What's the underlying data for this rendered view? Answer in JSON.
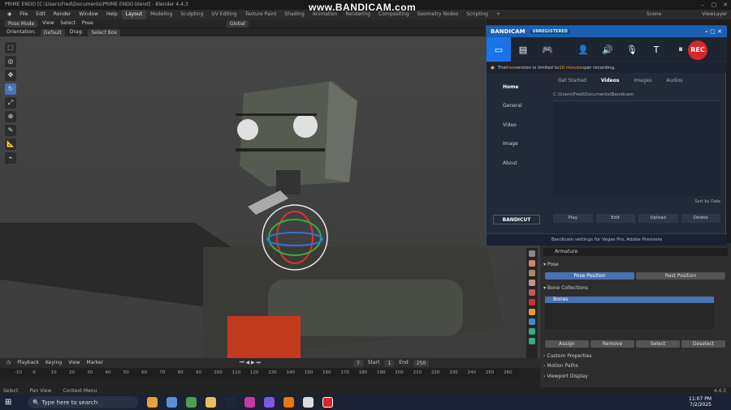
{
  "watermark": "www.BANDICAM.com",
  "blender": {
    "window_title": "PRIME ENDO [C:\\Users\\Fred\\Documents\\PRIME ENDO.blend] - Blender 4.4.3",
    "menu": [
      "File",
      "Edit",
      "Render",
      "Window",
      "Help"
    ],
    "workspaces": [
      "Layout",
      "Modeling",
      "Sculpting",
      "UV Editing",
      "Texture Paint",
      "Shading",
      "Animation",
      "Rendering",
      "Compositing",
      "Geometry Nodes",
      "Scripting"
    ],
    "scene": "Scene",
    "view_layer": "ViewLayer",
    "header": {
      "mode": "Pose Mode",
      "view": "View",
      "select": "Select",
      "pose": "Pose",
      "orientation_label": "Orientation:",
      "orientation": "Default",
      "drag_label": "Drag:",
      "drag": "Select Box",
      "transform": "Global"
    },
    "properties": {
      "object": "Armature",
      "pose_section": "Pose",
      "pose_position": "Pose Position",
      "rest_position": "Rest Position",
      "bone_collections": "Bone Collections",
      "bones": "Bones",
      "assign": "Assign",
      "remove": "Remove",
      "select": "Select",
      "deselect": "Deselect",
      "custom_properties": "Custom Properties",
      "motion_paths": "Motion Paths",
      "viewport_display": "Viewport Display"
    },
    "timeline": {
      "playback": "Playback",
      "keying": "Keying",
      "view": "View",
      "marker": "Marker",
      "current_frame": "7",
      "start_label": "Start",
      "start": "1",
      "end_label": "End",
      "end": "250",
      "ticks": [
        "-10",
        "0",
        "10",
        "20",
        "30",
        "40",
        "50",
        "60",
        "70",
        "80",
        "90",
        "100",
        "110",
        "120",
        "130",
        "140",
        "150",
        "160",
        "170",
        "180",
        "190",
        "200",
        "210",
        "220",
        "230",
        "240",
        "250",
        "260"
      ]
    },
    "status": {
      "select": "Select",
      "pan": "Pan View",
      "context": "Context Menu",
      "version": "4.4.3"
    }
  },
  "bandicam": {
    "brand": "BANDICAM",
    "badge": "UNREGISTERED",
    "rec": "REC",
    "notice_prefix": "The ",
    "notice_free": "free",
    "notice_mid": " version is limited to ",
    "notice_limit": "10 minutes",
    "notice_suffix": " per recording.",
    "nav": [
      "Home",
      "General",
      "Video",
      "Image",
      "About"
    ],
    "tabs": [
      "Get Started",
      "Videos",
      "Images",
      "Audios"
    ],
    "path": "C:\\Users\\Fred\\Documents\\Bandicam",
    "sort": "Sort by Date",
    "actions": [
      "Play",
      "Edit",
      "Upload",
      "Delete"
    ],
    "bandicut": "BANDICUT",
    "footer": "Bandicam settings for Vegas Pro, Adobe Premiere"
  },
  "taskbar": {
    "search": "Type here to search",
    "time": "11:07 PM",
    "date": "7/2/2025"
  }
}
